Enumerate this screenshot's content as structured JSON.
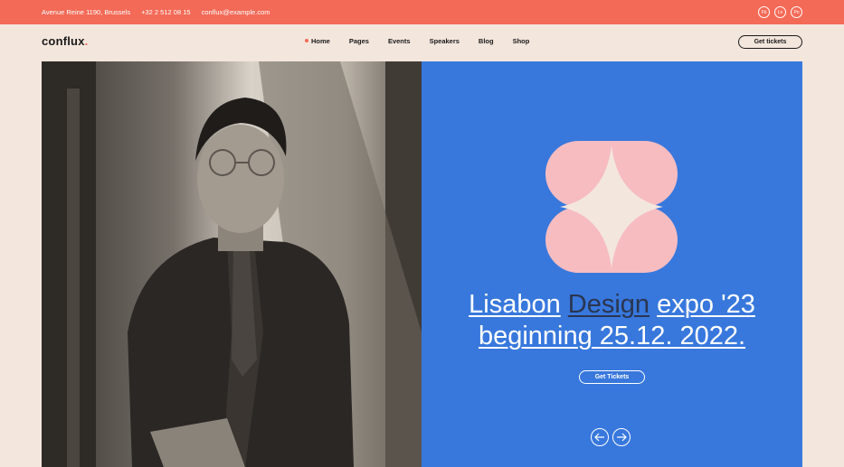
{
  "topbar": {
    "address": "Avenue Reine 1190, Brussels",
    "phone": "+32 2 512 08 15",
    "email": "conflux@example.com",
    "social": [
      "Fb",
      "Ln",
      "Pn"
    ]
  },
  "header": {
    "logo": "conflux",
    "nav": [
      "Home",
      "Pages",
      "Events",
      "Speakers",
      "Blog",
      "Shop"
    ],
    "cta": "Get tickets"
  },
  "hero": {
    "headline_line1_a": "Lisabon",
    "headline_line1_b": "Design",
    "headline_line1_c": "expo '23",
    "headline_line2": "beginning 25.12. 2022.",
    "cta": "Get Tickets",
    "photo_alt": "portrait of man with glasses",
    "colors": {
      "accent": "#f36a57",
      "panel": "#3878dd",
      "emblem": "#f7bcc0"
    }
  }
}
